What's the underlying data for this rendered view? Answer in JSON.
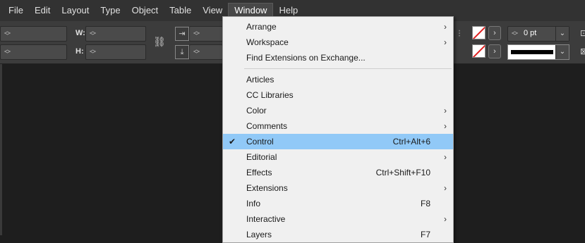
{
  "menubar": {
    "items": [
      "File",
      "Edit",
      "Layout",
      "Type",
      "Object",
      "Table",
      "View",
      "Window",
      "Help"
    ]
  },
  "control": {
    "w_label": "W:",
    "h_label": "H:",
    "stroke_weight": "0 pt"
  },
  "window_menu": {
    "group1": [
      {
        "label": "Arrange",
        "submenu": true
      },
      {
        "label": "Workspace",
        "submenu": true
      },
      {
        "label": "Find Extensions on Exchange...",
        "submenu": false
      }
    ],
    "group2": [
      {
        "label": "Articles",
        "shortcut": ""
      },
      {
        "label": "CC Libraries",
        "shortcut": ""
      },
      {
        "label": "Color",
        "shortcut": "",
        "submenu": true
      },
      {
        "label": "Comments",
        "shortcut": "",
        "submenu": true
      },
      {
        "label": "Control",
        "shortcut": "Ctrl+Alt+6",
        "checked": true
      },
      {
        "label": "Editorial",
        "shortcut": "",
        "submenu": true
      },
      {
        "label": "Effects",
        "shortcut": "Ctrl+Shift+F10"
      },
      {
        "label": "Extensions",
        "shortcut": "",
        "submenu": true
      },
      {
        "label": "Info",
        "shortcut": "F8"
      },
      {
        "label": "Interactive",
        "shortcut": "",
        "submenu": true
      },
      {
        "label": "Layers",
        "shortcut": "F7"
      }
    ]
  },
  "icons": {
    "check": "checkmark-icon",
    "submenu": "chevron-right-icon",
    "colors": {
      "highlight": "#91c9f7",
      "menu_bg": "#f0f0f0",
      "app_bg": "#1e1e1e"
    }
  }
}
